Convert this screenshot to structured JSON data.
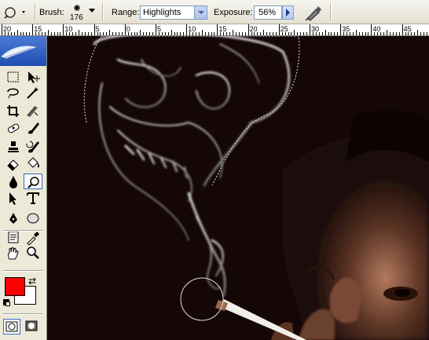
{
  "options": {
    "brush_label": "Brush:",
    "brush_size": "176",
    "range_label": "Range:",
    "range_value": "Highlights",
    "exposure_label": "Exposure:",
    "exposure_value": "56%"
  },
  "ruler": {
    "labels": [
      "20",
      "15",
      "10",
      "5",
      "0",
      "5",
      "10",
      "15",
      "20",
      "25",
      "30",
      "35",
      "40",
      "45"
    ]
  },
  "toolbox": {
    "tools": [
      "marquee-tool",
      "move-tool",
      "lasso-tool",
      "magic-wand-tool",
      "crop-tool",
      "slice-tool",
      "healing-brush-tool",
      "brush-tool",
      "clone-stamp-tool",
      "history-brush-tool",
      "eraser-tool",
      "paint-bucket-tool",
      "blur-tool",
      "dodge-tool",
      "path-selection-tool",
      "type-tool",
      "pen-tool",
      "ellipse-tool",
      "notes-tool",
      "eyedropper-tool",
      "hand-tool",
      "zoom-tool"
    ],
    "foreground_color": "#ff0000",
    "background_color": "#ffffff"
  }
}
